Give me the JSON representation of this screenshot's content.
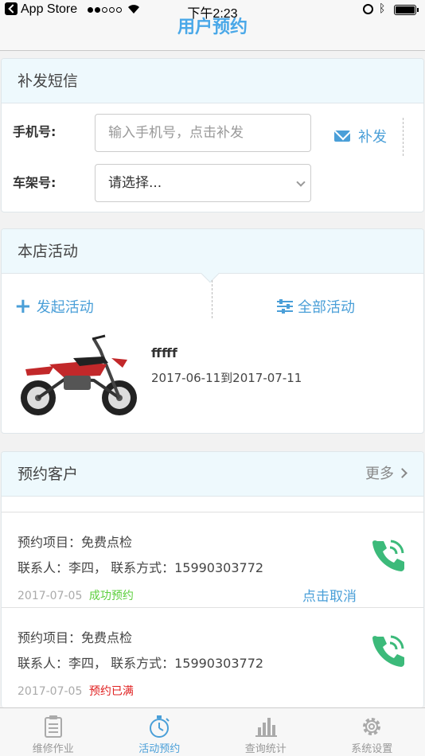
{
  "status_bar": {
    "carrier": "App Store",
    "time": "下午2:23"
  },
  "nav": {
    "title": "用户预约"
  },
  "sms_section": {
    "title": "补发短信",
    "phone_label": "手机号:",
    "phone_placeholder": "输入手机号，点击补发",
    "frame_label": "车架号:",
    "frame_select_value": "请选择...",
    "resend_label": "补发"
  },
  "activity_section": {
    "title": "本店活动",
    "start_label": "发起活动",
    "all_label": "全部活动",
    "item": {
      "name": "fffff",
      "date_range": "2017-06-11到2017-07-11"
    }
  },
  "booking_section": {
    "title": "预约客户",
    "more_label": "更多",
    "items": [
      {
        "project": "预约项目：免费点检",
        "contact": "联系人：李四，  联系方式：15990303772",
        "date": "2017-07-05",
        "status": "成功预约",
        "action": "点击取消"
      },
      {
        "project": "预约项目：免费点检",
        "contact": "联系人：李四，  联系方式：15990303772",
        "date": "2017-07-05",
        "status": "预约已满",
        "action": ""
      }
    ]
  },
  "tabbar": {
    "tabs": [
      {
        "label": "维修作业"
      },
      {
        "label": "活动预约"
      },
      {
        "label": "查询统计"
      },
      {
        "label": "系统设置"
      }
    ]
  },
  "colors": {
    "accent": "#4a9fd8",
    "success": "#5ccf3c",
    "danger": "#e02020",
    "phone_green": "#3cba7a"
  }
}
